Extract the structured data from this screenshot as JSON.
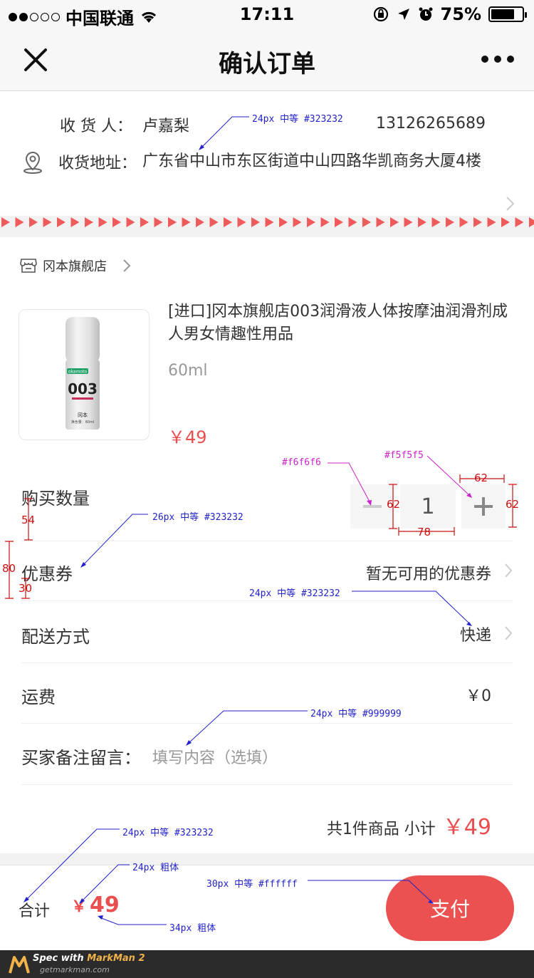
{
  "status_bar": {
    "carrier": "中国联通",
    "time": "17:11",
    "battery": "75%",
    "battery_level": 0.75
  },
  "nav": {
    "title": "确认订单"
  },
  "address": {
    "receiver_label": "收 货 人：",
    "receiver_name": "卢嘉梨",
    "phone": "13126265689",
    "address_label": "收货地址：",
    "address_text": "广东省中山市东区街道中山四路华凯商务大厦4楼"
  },
  "store": {
    "name": "冈本旗舰店"
  },
  "product": {
    "title": "[进口]冈本旗舰店003润滑液人体按摩油润滑剂成人男女情趣性用品",
    "spec": "60ml",
    "price": "￥49",
    "image_brand": "okamoto",
    "image_model": "003",
    "image_name": "冈本",
    "image_volume": "净含量：60ml"
  },
  "rows": {
    "quantity_label": "购买数量",
    "quantity_value": "1",
    "coupon_label": "优惠券",
    "coupon_value": "暂无可用的优惠券",
    "delivery_label": "配送方式",
    "delivery_value": "快递",
    "shipping_label": "运费",
    "shipping_value": "￥0",
    "remark_label": "买家备注留言：",
    "remark_placeholder": "填写内容（选填）"
  },
  "subtotal": {
    "text": "共1件商品  小计",
    "amount": "￥49"
  },
  "bottom": {
    "total_label": "合计",
    "currency": "￥",
    "total_amount": "49",
    "pay_label": "支付"
  },
  "annotations": {
    "a1": "24px 中等 #323232",
    "a2": "#f6f6f6",
    "a3": "#f5f5f5",
    "a4": "62",
    "a5": "62",
    "a6": "62",
    "a7": "78",
    "a8": "26px 中等 #323232",
    "a9": "54",
    "a10": "80",
    "a11": "30",
    "a12": "24px 中等 #323232",
    "a13": "24px 中等 #999999",
    "a14": "24px 中等 #323232",
    "a15": "24px 粗体",
    "a16": "30px 中等 #ffffff",
    "a17": "34px 粗体"
  },
  "footer": {
    "spec_with": "Spec with ",
    "brand": "MarkMan 2",
    "site": "getmarkman.com"
  },
  "colors": {
    "accent_red": "#e94f4f",
    "pay_button": "#ea5150",
    "text_main": "#323232",
    "text_muted": "#999999",
    "annotation_blue": "#2222cc",
    "annotation_magenta": "#cc22cc",
    "annotation_red": "#cc1111"
  }
}
